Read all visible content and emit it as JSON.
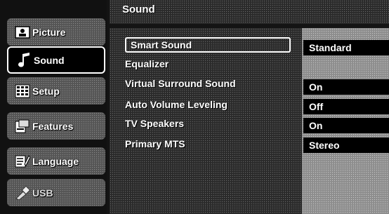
{
  "sidebar": {
    "items": [
      {
        "label": "Picture",
        "icon": "picture-icon"
      },
      {
        "label": "Sound",
        "icon": "music-note-icon"
      },
      {
        "label": "Setup",
        "icon": "grid-icon"
      },
      {
        "label": "Features",
        "icon": "features-icon"
      },
      {
        "label": "Language",
        "icon": "language-icon"
      },
      {
        "label": "USB",
        "icon": "usb-icon"
      }
    ]
  },
  "main": {
    "title": "Sound",
    "items": [
      {
        "label": "Smart Sound",
        "value": "Standard"
      },
      {
        "label": "Equalizer",
        "value": ""
      },
      {
        "label": "Virtual Surround Sound",
        "value": "On"
      },
      {
        "label": "Auto Volume Leveling",
        "value": "Off"
      },
      {
        "label": "TV Speakers",
        "value": "On"
      },
      {
        "label": "Primary MTS",
        "value": "Stereo"
      }
    ]
  }
}
